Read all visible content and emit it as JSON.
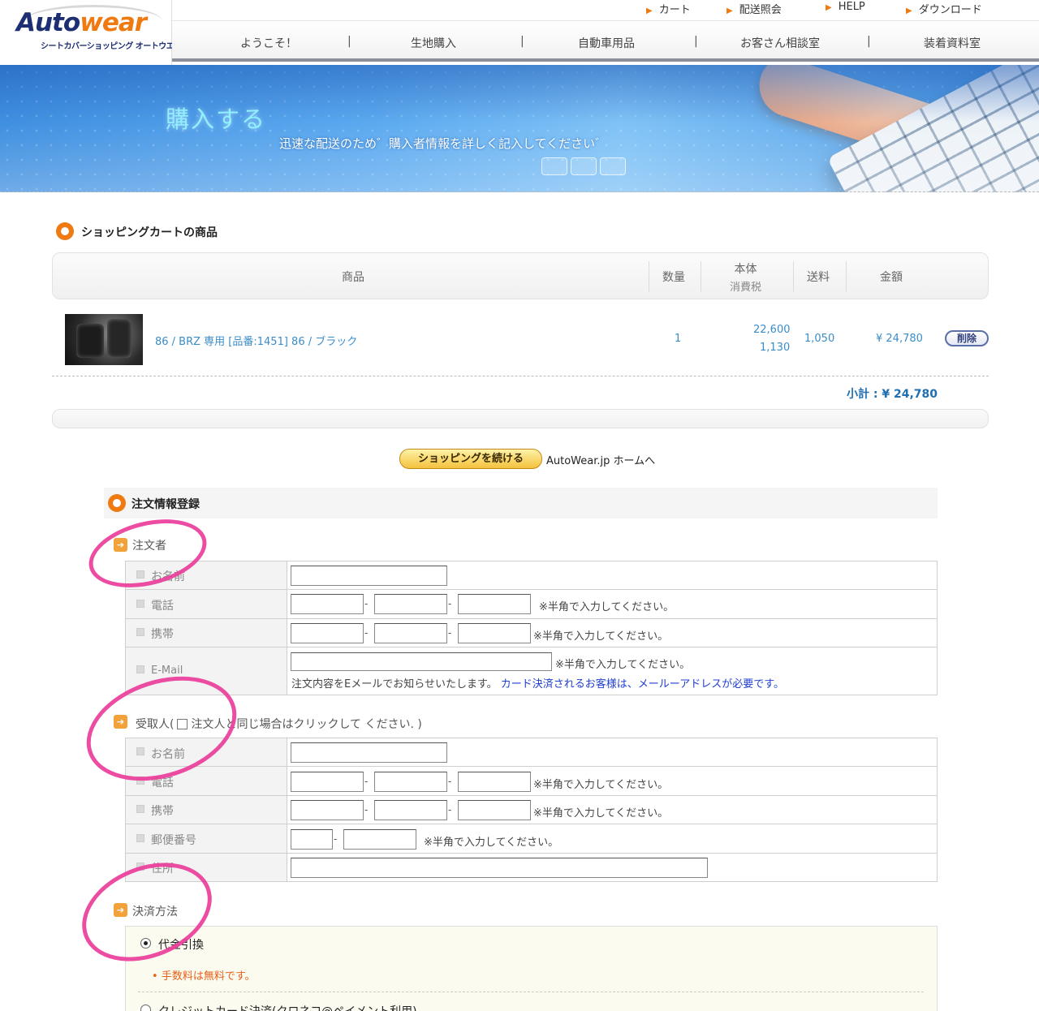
{
  "header": {
    "logo_part1": "Auto",
    "logo_part2": "wear",
    "logo_sub": "シートカバーショッピング オートウエア",
    "toplinks": [
      "カート",
      "配送照会",
      "HELP",
      "ダウンロード"
    ],
    "nav": [
      "ようこそ！",
      "生地購入",
      "自動車用品",
      "お客さん相談室",
      "装着資料室"
    ],
    "nav_separator": "|"
  },
  "banner": {
    "title": "購入する",
    "subtitle": "迅速な配送のため゛購入者情報を詳しく記入してください゛"
  },
  "cart": {
    "section_title": "ショッピングカートの商品",
    "columns": {
      "product": "商品",
      "quantity": "数量",
      "price": "本体",
      "tax": "消費税",
      "shipping": "送料",
      "amount": "金額"
    },
    "items": [
      {
        "name": "86 / BRZ 専用 [品番:1451] 86 / ブラック",
        "quantity": "1",
        "price": "22,600",
        "tax": "1,130",
        "shipping": "1,050",
        "amount": "¥ 24,780",
        "delete_label": "削除"
      }
    ],
    "subtotal": "小計 : ¥ 24,780",
    "continue_label": "ショッピングを続ける",
    "home_link": "AutoWear.jp ホームへ"
  },
  "order": {
    "section_title": "注文情報登録",
    "orderer": {
      "heading": "注文者",
      "fields": {
        "name": "お名前",
        "phone": "電話",
        "mobile": "携帯",
        "email": "E-Mail"
      },
      "note_half_width": "※半角で入力してください。",
      "email_note": "注文内容をEメールでお知らせいたします。",
      "email_note_blue": "カード決済されるお客様は、メールーアドレスが必要です。"
    },
    "recipient": {
      "heading_prefix": "受取人(",
      "same_as_orderer": "注文人と同じ場合はクリックして ください. )",
      "fields": {
        "name": "お名前",
        "phone": "電話",
        "mobile": "携帯",
        "postal": "郵便番号",
        "address": "住所"
      },
      "note_half_width": "※半角で入力してください。"
    },
    "payment": {
      "heading": "決済方法",
      "options": [
        {
          "label": "代金引換",
          "selected": true,
          "note": "手数料は無料です。"
        },
        {
          "label": "クレジットカード決済(クロネコ@ペイメント利用)",
          "selected": false
        }
      ]
    }
  },
  "colors": {
    "accent": "#f07a12",
    "link": "#3a8dc9",
    "annotation": "#ea3d9a"
  },
  "icons": {
    "section": "orange-ring-icon",
    "subsection": "arrow-right-box-icon",
    "toplink": "triangle-right-icon"
  }
}
